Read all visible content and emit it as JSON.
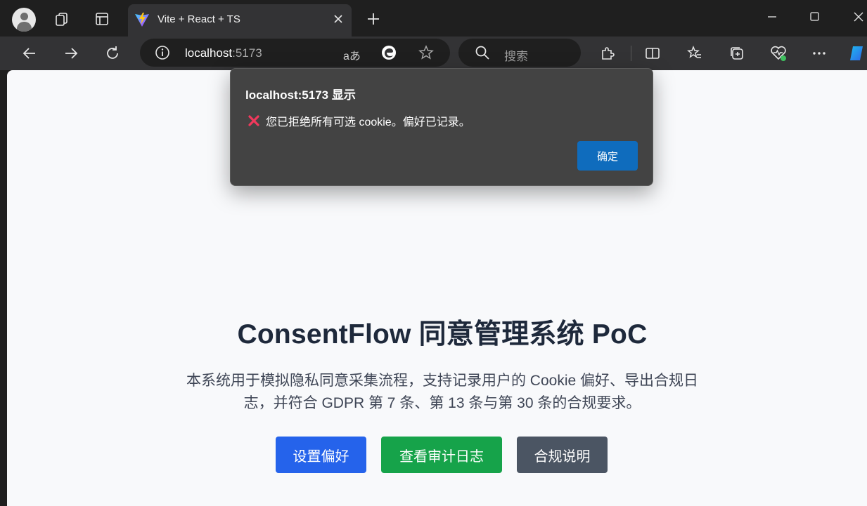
{
  "browser": {
    "tab": {
      "title": "Vite + React + TS"
    },
    "address_bar": {
      "host": "localhost",
      "port": ":5173"
    },
    "search_box": {
      "placeholder": "搜索"
    },
    "read_aloud_label": "aあ"
  },
  "dialog": {
    "title": "localhost:5173 显示",
    "message": "您已拒绝所有可选 cookie。偏好已记录。",
    "ok_label": "确定"
  },
  "page": {
    "title": "ConsentFlow 同意管理系统 PoC",
    "description": "本系统用于模拟隐私同意采集流程，支持记录用户的 Cookie 偏好、导出合规日志，并符合 GDPR 第 7 条、第 13 条与第 30 条的合规要求。",
    "buttons": {
      "preferences": "设置偏好",
      "audit_log": "查看审计日志",
      "compliance": "合规说明"
    }
  },
  "colors": {
    "primary": "#2563eb",
    "success": "#16a34a",
    "neutral": "#4b5563",
    "dialog_button": "#0f6cbd"
  }
}
